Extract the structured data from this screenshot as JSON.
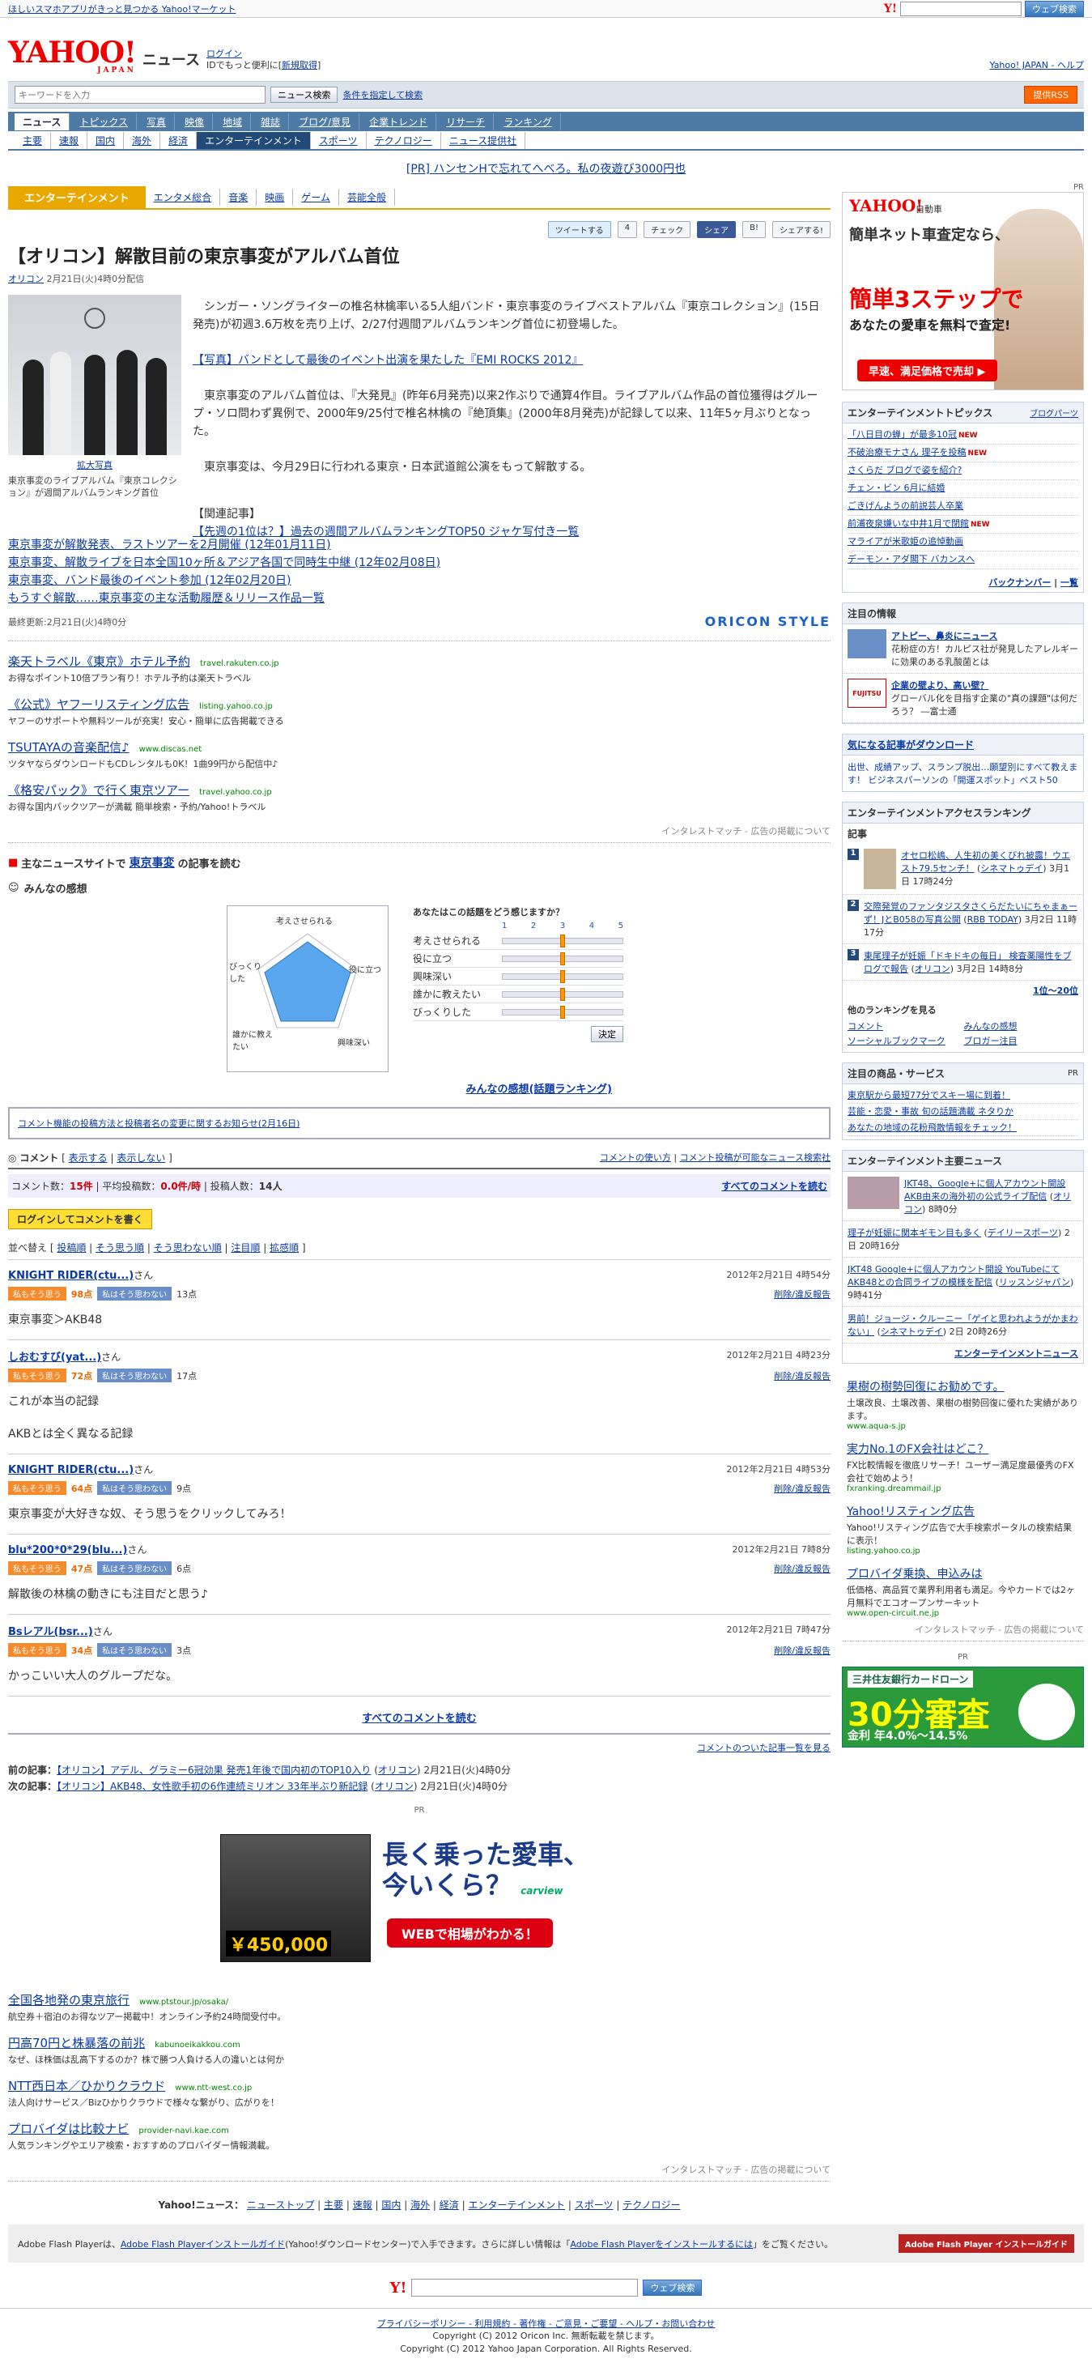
{
  "topbar": {
    "promo": "ほしいスマホアプリがきっと見つかる Yahoo!マーケット",
    "search_btn": "ウェブ検索"
  },
  "header": {
    "logo": "YAHOO!",
    "logo_sub": "JAPAN",
    "title": "ニュース",
    "login": "ログイン",
    "login_sub": "IDでもっと便利に[",
    "register": "新規取得",
    "login_end": "]",
    "right_links": "Yahoo! JAPAN - ヘルプ"
  },
  "searchbar": {
    "placeholder": "キーワードを入力",
    "search_btn": "ニュース検索",
    "advanced": "条件を指定して検索",
    "rss": "提供RSS"
  },
  "nav1": [
    "ニュース",
    "トピックス",
    "写真",
    "映像",
    "地域",
    "雑誌",
    "ブログ/意見",
    "企業トレンド",
    "リサーチ",
    "ランキング"
  ],
  "nav2": [
    "主要",
    "速報",
    "国内",
    "海外",
    "経済",
    "エンターテインメント",
    "スポーツ",
    "テクノロジー",
    "ニュース提供社"
  ],
  "pr_top": "[PR] ハンセンHで忘れてへべろ。私の夜遊び3000円也",
  "category": {
    "active": "エンターテインメント",
    "links": [
      "エンタメ総合",
      "音楽",
      "映画",
      "ゲーム",
      "芸能全般"
    ]
  },
  "share": {
    "tweet": "ツイートする",
    "tweet_count": "4",
    "check": "チェック",
    "fb": "シェア",
    "b": "B!",
    "yshare": "シェアする!"
  },
  "article": {
    "title": "【オリコン】解散目前の東京事変がアルバム首位",
    "source": "オリコン",
    "date": "2月21日(火)4時0分配信",
    "photo_link": "拡大写真",
    "photo_caption": "東京事変のライブアルバム『東京コレクション』が週間アルバムランキング首位",
    "p1": "シンガー・ソングライターの椎名林檎率いる5人組バンド・東京事変のライブベストアルバム『東京コレクション』(15日発売)が初週3.6万枚を売り上げ、2/27付週間アルバムランキング首位に初登場した。",
    "photo_story": "【写真】バンドとして最後のイベント出演を果たした『EMI ROCKS 2012』",
    "p2": "東京事変のアルバム首位は、『大発見』(昨年6月発売)以来2作ぶりで通算4作目。ライブアルバム作品の首位獲得はグループ・ソロ問わず異例で、2000年9/25付で椎名林檎の『絶頂集』(2000年8月発売)が記録して以来、11年5ヶ月ぶりとなった。",
    "p3": "東京事変は、今月29日に行われる東京・日本武道館公演をもって解散する。",
    "related_head": "【関連記事】",
    "related": [
      "【先週の1位は？】過去の週間アルバムランキングTOP50 ジャケ写付き一覧",
      "東京事変が解散発表、ラストツアーを2月開催 (12年01月11日)",
      "東京事変、解散ライブを日本全国10ヶ所＆アジア各国で同時生中継 (12年02月08日)",
      "東京事変、バンド最後のイベント参加 (12年02月20日)",
      "もうすぐ解散……東京事変の主な活動履歴＆リリース作品一覧"
    ],
    "updated": "最終更新:2月21日(火)4時0分",
    "oricon": "ORICON STYLE"
  },
  "ads": [
    {
      "title": "楽天トラベル《東京》ホテル予約",
      "url": "travel.rakuten.co.jp",
      "desc": "お得なポイント10倍プラン有り！ホテル予約は楽天トラベル"
    },
    {
      "title": "《公式》ヤフーリスティング広告",
      "url": "listing.yahoo.co.jp",
      "desc": "ヤフーのサポートや無料ツールが充実！安心・簡単に広告掲載できる"
    },
    {
      "title": "TSUTAYAの音楽配信♪",
      "url": "www.discas.net",
      "desc": "ツタヤならダウンロードもCDレンタルも0K！1曲99円から配信中♪"
    },
    {
      "title": "《格安パック》で行く東京ツアー",
      "url": "travel.yahoo.co.jp",
      "desc": "お得な国内パックツアーが満載 簡単検索・予約/Yahoo!トラベル"
    }
  ],
  "admatch": "インタレストマッチ - 広告の掲載について",
  "other_read": {
    "pre": "主なニュースサイトで",
    "kw": "東京事変",
    "post": "の記事を読む"
  },
  "feelings": {
    "title": "みんなの感想",
    "question": "あなたはこの話題をどう感じますか？",
    "scale": [
      "1",
      "2",
      "3",
      "4",
      "5"
    ],
    "items": [
      {
        "label": "考えさせられる",
        "value": 3
      },
      {
        "label": "役に立つ",
        "value": 3
      },
      {
        "label": "興味深い",
        "value": 3
      },
      {
        "label": "誰かに教えたい",
        "value": 3
      },
      {
        "label": "びっくりした",
        "value": 3
      }
    ],
    "radar_labels": [
      "考えさせられる",
      "役に立つ",
      "興味深い",
      "誰かに教えたい",
      "びっくりした"
    ],
    "decide": "決定",
    "ranking": "みんなの感想(話題ランキング)"
  },
  "notice": "コメント機能の投稿方法と投稿者名の変更に関するお知らせ(2月16日)",
  "comments_header": {
    "label": "コメント",
    "show": "表示する",
    "hide": "表示しない",
    "howto": "コメントの使い方",
    "list": "コメント投稿が可能なニュース検索社"
  },
  "comment_stats": {
    "count_label": "コメント数：",
    "count": "15件",
    "avg_label": "平均投稿数：",
    "avg": "0.0件/時",
    "poster_label": "投稿人数：",
    "posters": "14人",
    "all": "すべてのコメントを読む"
  },
  "write_btn": "ログインしてコメントを書く",
  "sort": {
    "label": "並べ替え [",
    "opts": [
      "投稿順",
      "そう思う順",
      "そう思わない順",
      "注目順",
      "拡感順"
    ]
  },
  "vote": {
    "yes": "私もそう思う",
    "no": "私はそう思わない",
    "report": "削除/違反報告"
  },
  "comments": [
    {
      "name": "KNIGHT RIDER(ctu...)",
      "san": "さん",
      "date": "2012年2月21日 4時54分",
      "yes": "98点",
      "no": "13点",
      "text": "東京事変＞AKB48"
    },
    {
      "name": "しおむすび(yat...)",
      "san": "さん",
      "date": "2012年2月21日 4時23分",
      "yes": "72点",
      "no": "17点",
      "text": "これが本当の記録\n\nAKBとは全く異なる記録"
    },
    {
      "name": "KNIGHT RIDER(ctu...)",
      "san": "さん",
      "date": "2012年2月21日 4時53分",
      "yes": "64点",
      "no": "9点",
      "text": "東京事変が大好きな奴、そう思うをクリックしてみろ！"
    },
    {
      "name": "blu*200*0*29(blu...)",
      "san": "さん",
      "date": "2012年2月21日 7時8分",
      "yes": "47点",
      "no": "6点",
      "text": "解散後の林檎の動きにも注目だと思う♪"
    },
    {
      "name": "Bsレアル(bsr...)",
      "san": "さん",
      "date": "2012年2月21日 7時47分",
      "yes": "34点",
      "no": "3点",
      "text": "かっこいい大人のグループだな。"
    }
  ],
  "all_comments": "すべてのコメントを読む",
  "commented_list": "コメントのついた記事一覧を見る",
  "prev_next": {
    "prev_label": "前の記事：",
    "prev": "【オリコン】アデル、グラミー6冠効果 発売1年後で国内初のTOP10入り",
    "prev_src": "オリコン",
    "prev_date": "2月21日(火)4時0分",
    "next_label": "次の記事：",
    "next": "【オリコン】AKB48、女性歌手初の6作連続ミリオン 33年半ぶり新記録",
    "next_src": "オリコン",
    "next_date": "2月21日(火)4時0分"
  },
  "bigad": {
    "pr": "PR",
    "line1": "長く乗った愛車、",
    "line2": "今いくら？",
    "price": "￥450,000",
    "btn": "WEBで相場がわかる！",
    "brand": "carview"
  },
  "ads2": [
    {
      "title": "全国各地発の東京旅行",
      "url": "www.ptstour.jp/osaka/",
      "desc": "航空券＋宿泊のお得なツアー掲載中！オンライン予約24時間受付中。"
    },
    {
      "title": "円高70円と株暴落の前兆",
      "url": "kabunoeikakkou.com",
      "desc": "なぜ、ほ株価は乱高下するのか？株で勝つ人負ける人の違いとは何か"
    },
    {
      "title": "NTT西日本／ひかりクラウド",
      "url": "www.ntt-west.co.jp",
      "desc": "法人向けサービス／Bizひかりクラウドで様々な繋がり、広がりを！"
    },
    {
      "title": "プロバイダは比較ナビ",
      "url": "provider-navi.kae.com",
      "desc": "人気ランキングやエリア検索・おすすめのプロバイダー情報満載。"
    }
  ],
  "footer_nav": {
    "label": "Yahoo!ニュース：",
    "links": [
      "ニューストップ",
      "主要",
      "速報",
      "国内",
      "海外",
      "経済",
      "エンターテインメント",
      "スポーツ",
      "テクノロジー"
    ]
  },
  "flash": {
    "text": "Adobe Flash Playerは、",
    "link1": "Adobe Flash Playerインストールガイド",
    "mid": "(Yahoo!ダウンロードセンター)で入手できます。さらに詳しい情報は「",
    "link2": "Adobe Flash Playerをインストールするには",
    "end": "」をご覧ください。",
    "logo": "Adobe Flash Player インストールガイド"
  },
  "footer_search_btn": "ウェブ検索",
  "footer_links": "プライバシーポリシー - 利用規約 - 著作権 - ご意見・ご要望 - ヘルプ・お問い合わせ",
  "copyright": [
    "Copyright (C) 2012 Oricon Inc. 無断転載を禁じます。",
    "Copyright (C) 2012 Yahoo Japan Corporation. All Rights Reserved."
  ],
  "side": {
    "pr": "PR",
    "carad": {
      "logo": "YAHOO!",
      "sub": "自動車",
      "h": "簡単ネット車査定なら、",
      "big": "簡単3ステップで",
      "sub2": "あなたの愛車を無料で査定!",
      "btn": "早速、満足価格で売却 ▶"
    },
    "topics": {
      "title": "エンターテインメントトピックス",
      "tag": "ブログパーツ",
      "items": [
        {
          "t": "「八日目の蝉」が最多10冠",
          "n": "NEW"
        },
        {
          "t": "不破治療モナさん 理子を投稿",
          "n": "NEW"
        },
        {
          "t": "さくらだ ブログで姿を紹介?",
          "n": ""
        },
        {
          "t": "チェン・ビン 6月に結婚",
          "n": ""
        },
        {
          "t": "ごきげんようの前説芸人卒業",
          "n": ""
        },
        {
          "t": "前浦夜泉嫌いな中井1月で閉館",
          "n": "NEW"
        },
        {
          "t": "マライアが米歌姫の追悼動画",
          "n": ""
        },
        {
          "t": "デーモン・アダ閣下 バカンスへ",
          "n": ""
        }
      ],
      "back": "バックナンバー",
      "list": "一覧"
    },
    "attn": {
      "title": "注目の情報",
      "items": [
        {
          "h": "アトピー、鼻炎にニュース",
          "d": "花粉症の方！カルピス社が発見したアレルギーに効果のある乳酸菌とは",
          "th": ""
        },
        {
          "h": "企業の壁より、高い壁？",
          "d": "グローバル化を目指す企業の\"真の課題\"は何だろう？ ―富士通",
          "th": "FUJITSU"
        }
      ]
    },
    "dl": {
      "title": "気になる記事がダウンロード",
      "desc": "出世、成績アップ、スランプ脱出…願望別にすべて教えます！ ビジネスパーソンの「開運スポット」ベスト50"
    },
    "rank": {
      "title": "エンターテインメントアクセスランキング",
      "cat": "記事",
      "items": [
        {
          "t": "オセロ松嶋、人生初の美くびれ披露！ウエスト79.5センチ！",
          "s": "シネマトゥデイ",
          "d": "3月1日 17時24分"
        },
        {
          "t": "交際発覚のファンタジスタさくらだたいにちゃまぁーず！JとB058の写真公開",
          "s": "RBB TODAY",
          "d": "3月2日 11時17分"
        },
        {
          "t": "東尾理子が妊娠「ドキドキの毎日」 検査薬陽性をブログで報告",
          "s": "オリコン",
          "d": "3月2日 14時8分"
        }
      ],
      "more": "1位〜20位"
    },
    "other_rank": {
      "title": "他のランキングを見る",
      "links": [
        "コメント",
        "みんなの感想",
        "ソーシャルブックマーク",
        "ブロガー注目"
      ]
    },
    "event": {
      "title": "注目の商品・サービス",
      "pr": "PR",
      "items": [
        "東京駅から最短77分でスキー場に到着！",
        "芸能・恋愛・事故 旬の話題満載 ネタりか",
        "あなたの地域の花粉飛散情報をチェック！"
      ]
    },
    "main_news": {
      "title": "エンターテインメント主要ニュース",
      "items": [
        {
          "t": "JKT48、Google+に個人アカウント開設 AKB由来の海外初の公式ライブ配信",
          "s": "オリコン",
          "d": "8時0分"
        },
        {
          "t": "理子が妊娠に関本ギモン目も多く",
          "s": "デイリースポーツ",
          "d": "2日 20時16分"
        },
        {
          "t": "JKT48 Google+に個人アカウント開設 YouTubeにてAKB48との合同ライブの模様を配信",
          "s": "リッスンジャパン",
          "d": "9時41分"
        },
        {
          "t": "男前！ジョージ・クルーニー「ゲイと思われようがかまわない」",
          "s": "シネマトゥデイ",
          "d": "2日 20時26分"
        }
      ],
      "more": "エンターテインメントニュース"
    },
    "ads": [
      {
        "t": "果樹の樹勢回復にお勧めです。",
        "d": "土壌改良、土壌改善、果樹の樹勢回復に優れた実績があります。",
        "u": "www.aqua-s.jp"
      },
      {
        "t": "実力No.1のFX会社はどこ？",
        "d": "FX比較情報を徹底リサーチ！ユーザー満足度最優秀のFX会社で始めよう！",
        "u": "fxranking.dreammail.jp"
      },
      {
        "t": "Yahoo!リスティング広告",
        "d": "Yahoo!リスティング広告で大手検索ポータルの検索結果に表示！",
        "u": "listing.yahoo.co.jp"
      },
      {
        "t": "プロバイダ乗換、申込みは",
        "d": "低価格、高品質で業界利用者も満足。今やカードでは2ヶ月無料でエコオープンサーキット",
        "u": "www.open-circuit.ne.jp"
      }
    ],
    "admatch": "インタレストマッチ - 広告の掲載について",
    "loan": {
      "pr": "PR",
      "t": "三井住友銀行カードローン",
      "n": "30分審査",
      "n2": "金利 年4.0%〜14.5%"
    }
  }
}
